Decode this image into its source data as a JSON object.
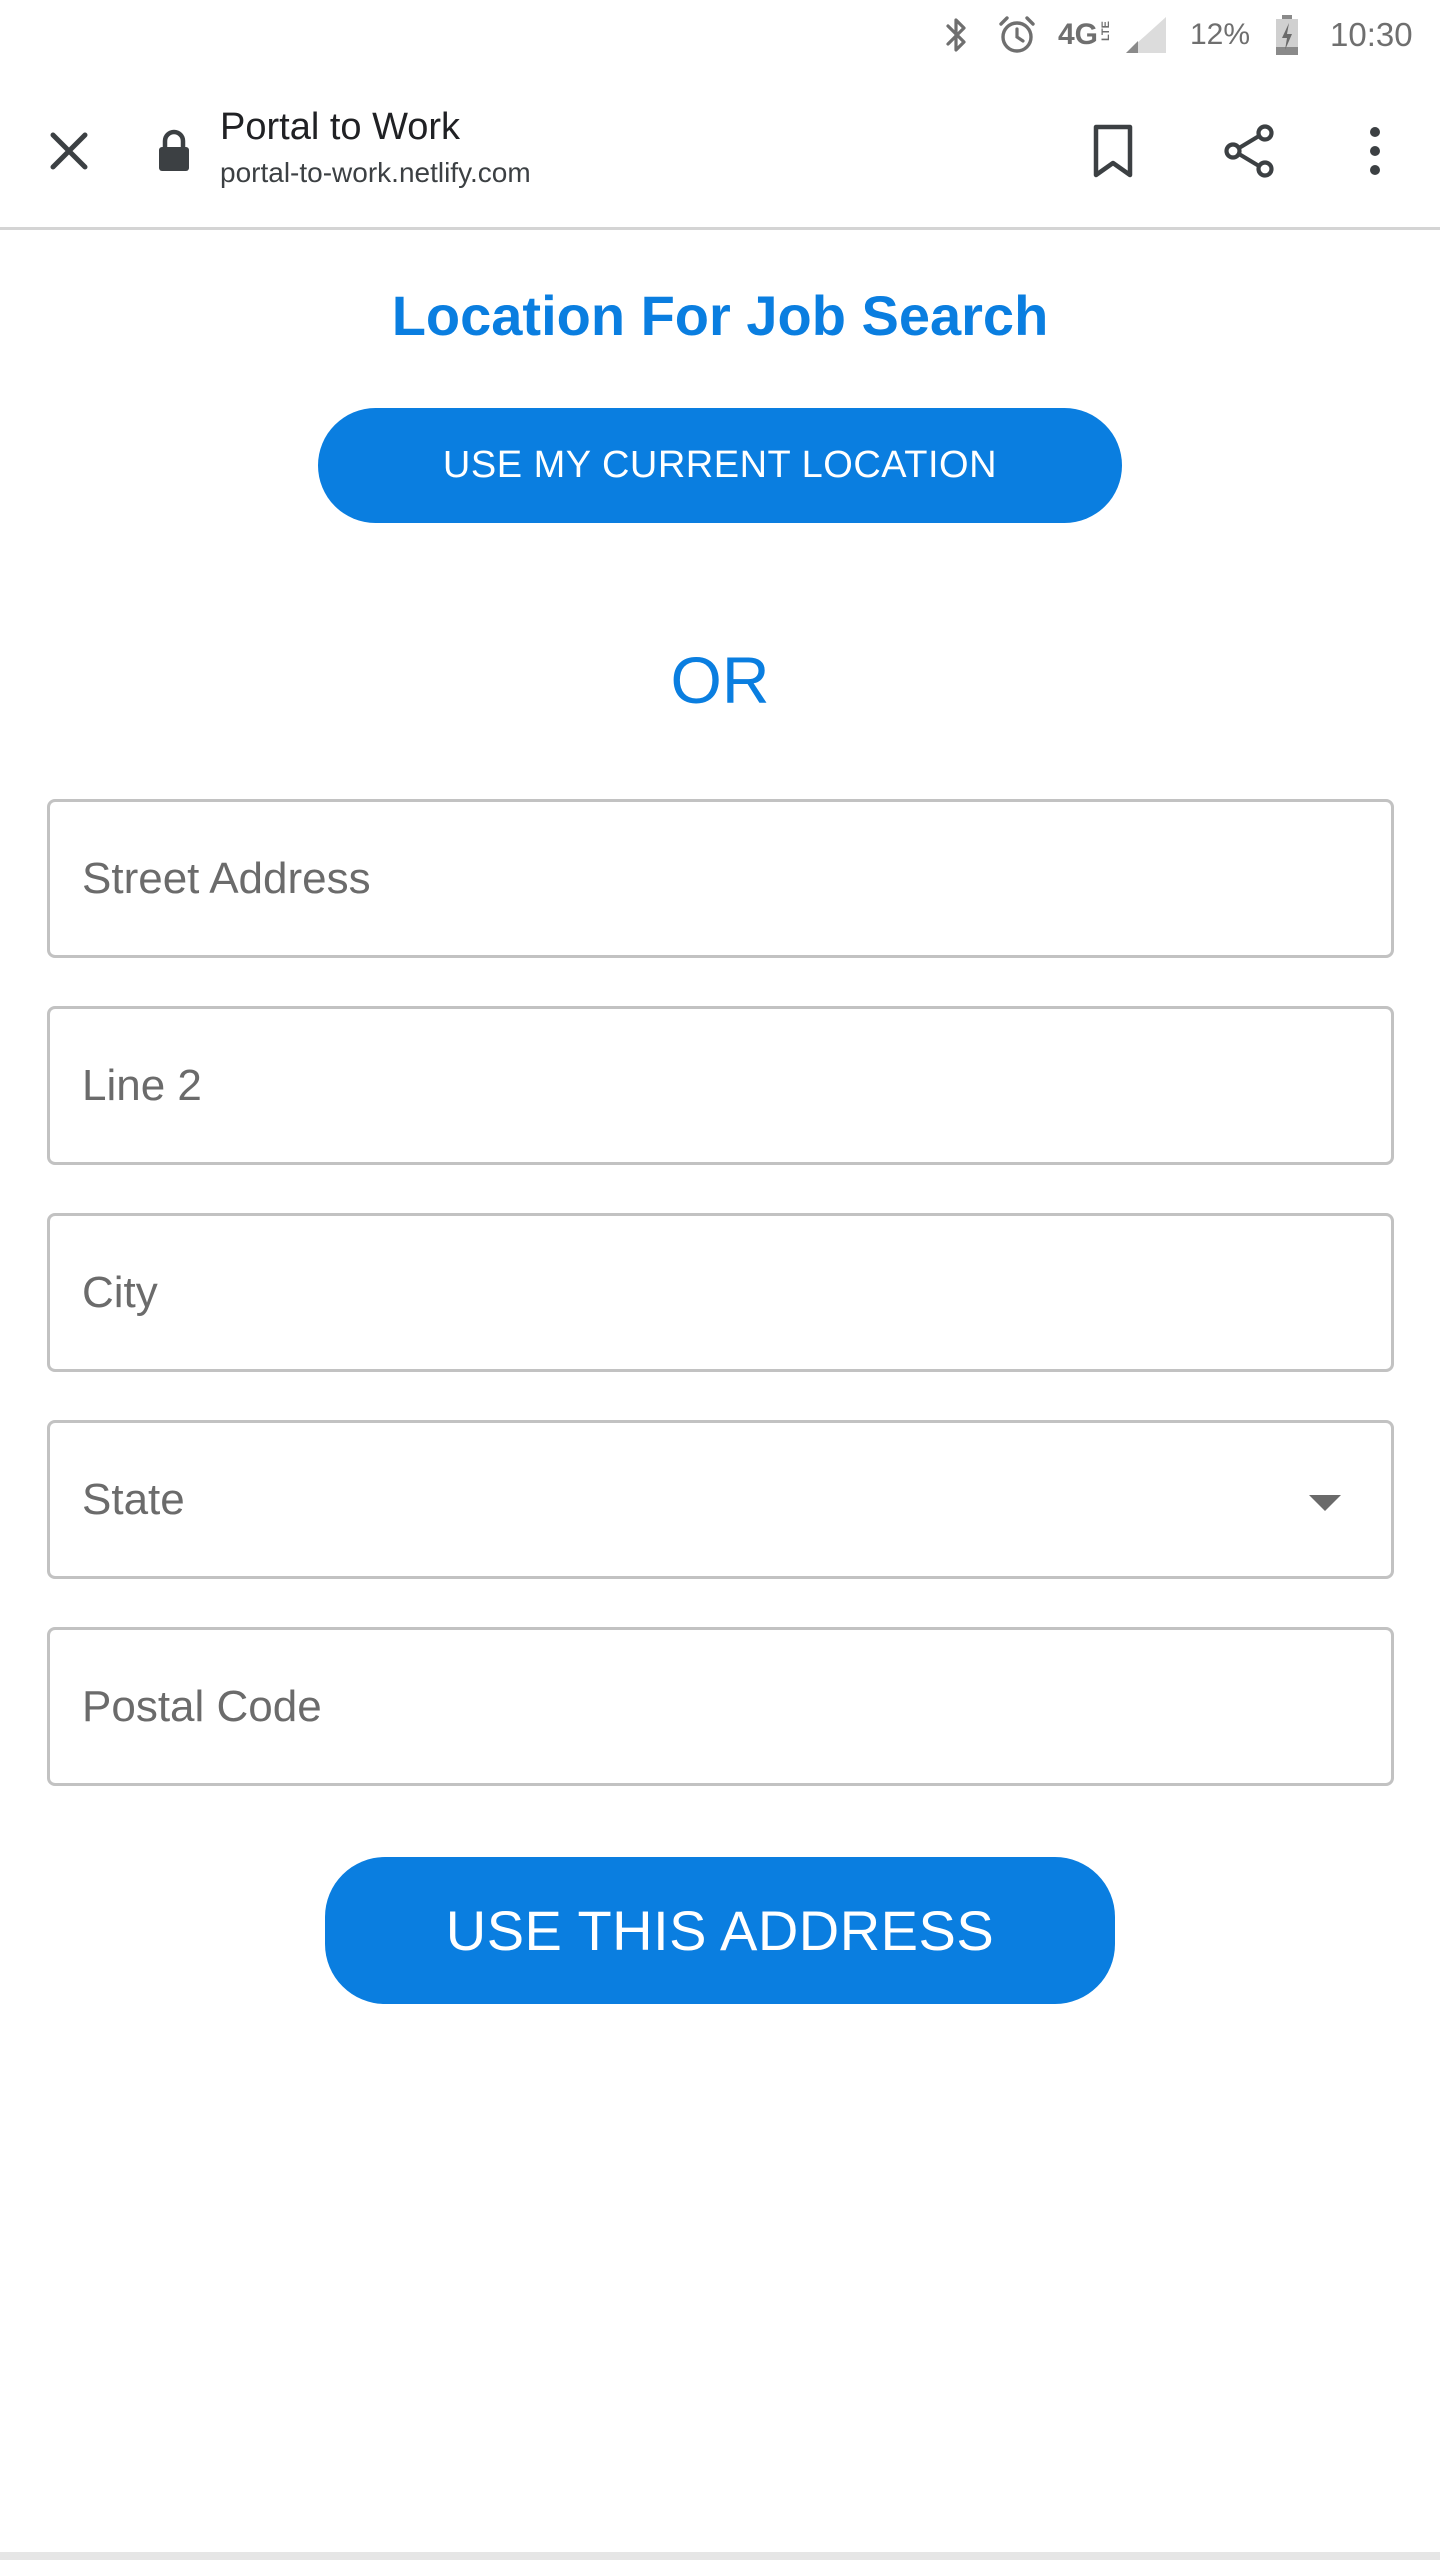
{
  "status_bar": {
    "network": "4G",
    "network_sub": "LTE",
    "battery_percent": "12%",
    "time": "10:30",
    "icons": [
      "bluetooth-icon",
      "alarm-icon",
      "signal-icon",
      "battery-charging-icon"
    ]
  },
  "browser": {
    "page_title": "Portal to Work",
    "url": "portal-to-work.netlify.com",
    "icons": [
      "close-icon",
      "lock-icon",
      "bookmark-icon",
      "share-icon",
      "more-vert-icon"
    ]
  },
  "page": {
    "heading": "Location For Job Search",
    "current_location_button": "USE MY CURRENT LOCATION",
    "or_text": "OR",
    "fields": {
      "street_placeholder": "Street Address",
      "line2_placeholder": "Line 2",
      "city_placeholder": "City",
      "state_value": "State",
      "postal_placeholder": "Postal Code"
    },
    "submit_button": "USE THIS ADDRESS"
  },
  "colors": {
    "accent": "#0a7ee0",
    "placeholder": "#6b6b6b",
    "border": "#c2c2c2"
  }
}
